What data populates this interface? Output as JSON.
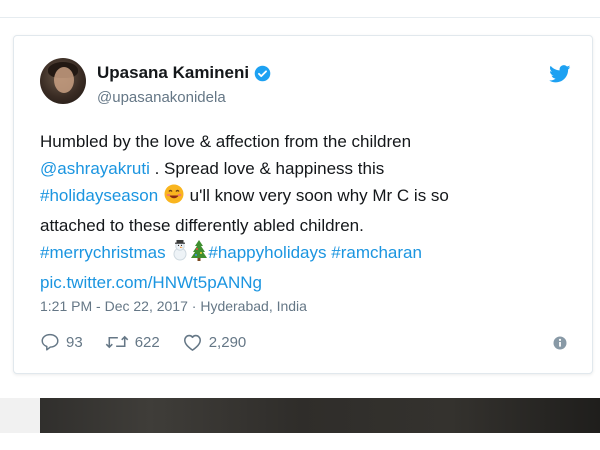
{
  "tweet": {
    "display_name": "Upasana Kamineni",
    "handle": "@upasanakonidela",
    "text_lines": [
      [
        {
          "t": "Humbled by the love & affection from the children",
          "link": false
        }
      ],
      [
        {
          "t": "@ashrayakruti",
          "link": true
        },
        {
          "t": " . Spread love & happiness this",
          "link": false
        }
      ],
      [
        {
          "t": "#holidayseason",
          "link": true
        },
        {
          "t": " ",
          "link": false
        },
        {
          "emoji": "smiling-face-emoji"
        },
        {
          "t": " u'll know very soon why Mr C is so",
          "link": false
        }
      ],
      [
        {
          "t": "attached to these differently abled children.",
          "link": false
        }
      ],
      [
        {
          "t": "#merrychristmas",
          "link": true
        },
        {
          "t": " ",
          "link": false
        },
        {
          "emoji": "snowman-emoji"
        },
        {
          "emoji": "christmas-tree-emoji"
        },
        {
          "t": "#happyholidays",
          "link": true
        },
        {
          "t": " ",
          "link": false
        },
        {
          "t": "#ramcharan",
          "link": true
        }
      ],
      [
        {
          "t": "pic.twitter.com/HNWt5pANNg",
          "link": true
        }
      ]
    ],
    "timestamp": "1:21 PM - Dec 22, 2017",
    "separator": " · ",
    "location": "Hyderabad, India",
    "replies": "93",
    "retweets": "622",
    "likes": "2,290"
  },
  "icons": {
    "verified": "verified-badge-icon",
    "bird": "twitter-bird-icon",
    "reply": "reply-icon",
    "retweet": "retweet-icon",
    "like": "heart-icon",
    "info": "info-icon"
  },
  "colors": {
    "link": "#1b95e0",
    "twitter_blue": "#1da1f2",
    "muted": "#657786",
    "text": "#14171a"
  }
}
